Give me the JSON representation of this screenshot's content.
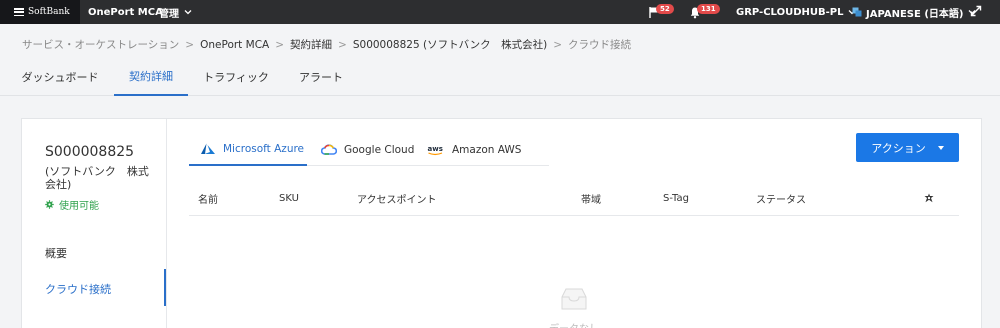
{
  "topbar": {
    "logo": "SoftBank",
    "app_name": "OnePort MCA",
    "manage_label": "管理",
    "flag_count": "52",
    "bell_count": "131",
    "org": "GRP-CLOUDHUB-PL",
    "language": "JAPANESE (日本語)",
    "colors": {
      "bar": "#2d2e30",
      "badge": "#e24a4a"
    }
  },
  "breadcrumb": {
    "items": [
      "サービス・オーケストレーション",
      "OnePort MCA",
      "契約詳細",
      "S000008825 (ソフトバンク　株式会社)",
      "クラウド接続"
    ],
    "separator": ">"
  },
  "tabs": [
    "ダッシュボード",
    "契約詳細",
    "トラフィック",
    "アラート"
  ],
  "contract": {
    "id": "S000008825",
    "company": "(ソフトバンク　株式会社)",
    "status": "使用可能"
  },
  "side_nav": [
    "概要",
    "クラウド接続"
  ],
  "cloud_tabs": [
    "Microsoft Azure",
    "Google Cloud",
    "Amazon AWS"
  ],
  "action_button": "アクション",
  "table": {
    "columns": [
      "名前",
      "SKU",
      "アクセスポイント",
      "帯域",
      "S-Tag",
      "ステータス"
    ]
  },
  "empty_text": "データなし",
  "accent_color": "#2a6fc9",
  "button_color": "#1b78e6",
  "status_color": "#2fa14c"
}
